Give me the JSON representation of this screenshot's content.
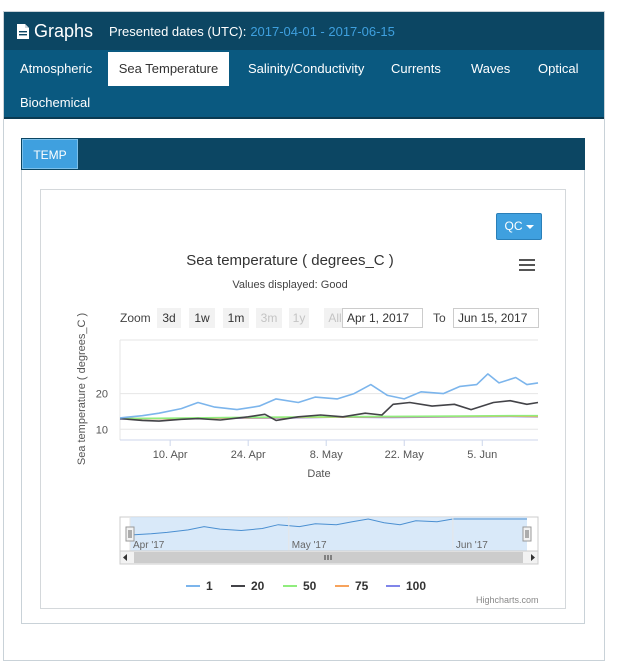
{
  "header": {
    "title": "Graphs",
    "dates_label": "Presented dates (UTC):",
    "dates_value": "2017-04-01 - 2017-06-15"
  },
  "tabs": [
    {
      "label": "Atmospheric",
      "active": false
    },
    {
      "label": "Sea Temperature",
      "active": true
    },
    {
      "label": "Salinity/Conductivity",
      "active": false
    },
    {
      "label": "Currents",
      "active": false
    },
    {
      "label": "Waves",
      "active": false
    },
    {
      "label": "Optical",
      "active": false
    },
    {
      "label": "Biochemical",
      "active": false
    }
  ],
  "section_button": "TEMP",
  "qc_button": "QC",
  "zoom": {
    "label": "Zoom",
    "buttons": [
      "3d",
      "1w",
      "1m",
      "3m",
      "1y",
      "All"
    ],
    "from_value": "Apr 1, 2017",
    "to_label": "To",
    "to_value": "Jun 15, 2017"
  },
  "credit": "Highcharts.com",
  "colors": {
    "header_bg": "#0c4663",
    "nav_bg": "#0a5980",
    "accent": "#3fa0df"
  },
  "chart_data": {
    "type": "line",
    "title": "Sea temperature ( degrees_C )",
    "subtitle": "Values displayed: Good",
    "xlabel": "Date",
    "ylabel": "Sea temperature ( degrees_C )",
    "yticks": [
      10,
      20
    ],
    "ylim": [
      7,
      35
    ],
    "xlim": [
      "2017-04-01",
      "2017-06-15"
    ],
    "xticks": [
      {
        "date": "2017-04-10",
        "label": "10. Apr"
      },
      {
        "date": "2017-04-24",
        "label": "24. Apr"
      },
      {
        "date": "2017-05-08",
        "label": "8. May"
      },
      {
        "date": "2017-05-22",
        "label": "22. May"
      },
      {
        "date": "2017-06-05",
        "label": "5. Jun"
      }
    ],
    "navigator_labels": [
      {
        "date": "2017-04-01",
        "label": "Apr '17"
      },
      {
        "date": "2017-05-01",
        "label": "May '17"
      },
      {
        "date": "2017-06-01",
        "label": "Jun '17"
      }
    ],
    "legend_position": "bottom-center",
    "series": [
      {
        "name": "1",
        "color": "#7cb5ec",
        "x": [
          "2017-04-01",
          "2017-04-05",
          "2017-04-08",
          "2017-04-12",
          "2017-04-15",
          "2017-04-18",
          "2017-04-22",
          "2017-04-26",
          "2017-04-29",
          "2017-05-03",
          "2017-05-06",
          "2017-05-10",
          "2017-05-13",
          "2017-05-16",
          "2017-05-19",
          "2017-05-22",
          "2017-05-25",
          "2017-05-29",
          "2017-06-01",
          "2017-06-04",
          "2017-06-06",
          "2017-06-08",
          "2017-06-11",
          "2017-06-13",
          "2017-06-15"
        ],
        "y": [
          13.2,
          13.8,
          14.5,
          15.8,
          17.5,
          16.2,
          15.5,
          16.5,
          18.5,
          17.5,
          19.0,
          18.5,
          20.0,
          22.5,
          19.5,
          18.5,
          20.5,
          20.0,
          22.0,
          22.5,
          25.5,
          23.0,
          24.5,
          22.5,
          23.0
        ]
      },
      {
        "name": "20",
        "color": "#434348",
        "x": [
          "2017-04-01",
          "2017-04-05",
          "2017-04-08",
          "2017-04-12",
          "2017-04-15",
          "2017-04-19",
          "2017-04-24",
          "2017-04-27",
          "2017-04-29",
          "2017-05-03",
          "2017-05-07",
          "2017-05-11",
          "2017-05-15",
          "2017-05-18",
          "2017-05-20",
          "2017-05-23",
          "2017-05-27",
          "2017-05-31",
          "2017-06-03",
          "2017-06-07",
          "2017-06-10",
          "2017-06-13",
          "2017-06-15"
        ],
        "y": [
          13.0,
          12.5,
          12.3,
          12.8,
          13.0,
          12.6,
          13.5,
          14.2,
          12.5,
          13.5,
          14.0,
          13.5,
          14.5,
          14.0,
          17.0,
          17.5,
          16.5,
          17.0,
          15.5,
          17.5,
          18.0,
          17.0,
          17.5
        ]
      },
      {
        "name": "50",
        "color": "#90ed7d",
        "x": [
          "2017-04-01",
          "2017-04-10",
          "2017-04-20",
          "2017-05-01",
          "2017-05-10",
          "2017-05-20",
          "2017-06-01",
          "2017-06-10",
          "2017-06-15"
        ],
        "y": [
          13.0,
          13.1,
          13.3,
          13.4,
          13.5,
          13.6,
          13.7,
          13.8,
          13.8
        ]
      },
      {
        "name": "75",
        "color": "#f7a35c",
        "x": [
          "2017-04-01",
          "2017-04-10",
          "2017-04-20",
          "2017-05-01",
          "2017-05-10",
          "2017-05-20",
          "2017-06-01",
          "2017-06-10",
          "2017-06-15"
        ],
        "y": [
          13.0,
          13.0,
          13.2,
          13.3,
          13.4,
          13.5,
          13.6,
          13.7,
          13.6
        ]
      },
      {
        "name": "100",
        "color": "#8085e9",
        "x": [
          "2017-04-01",
          "2017-04-10",
          "2017-04-20",
          "2017-05-01",
          "2017-05-10",
          "2017-05-20",
          "2017-06-01",
          "2017-06-10",
          "2017-06-15"
        ],
        "y": [
          12.9,
          13.0,
          13.1,
          13.2,
          13.4,
          13.3,
          13.5,
          13.6,
          13.5
        ]
      }
    ]
  }
}
